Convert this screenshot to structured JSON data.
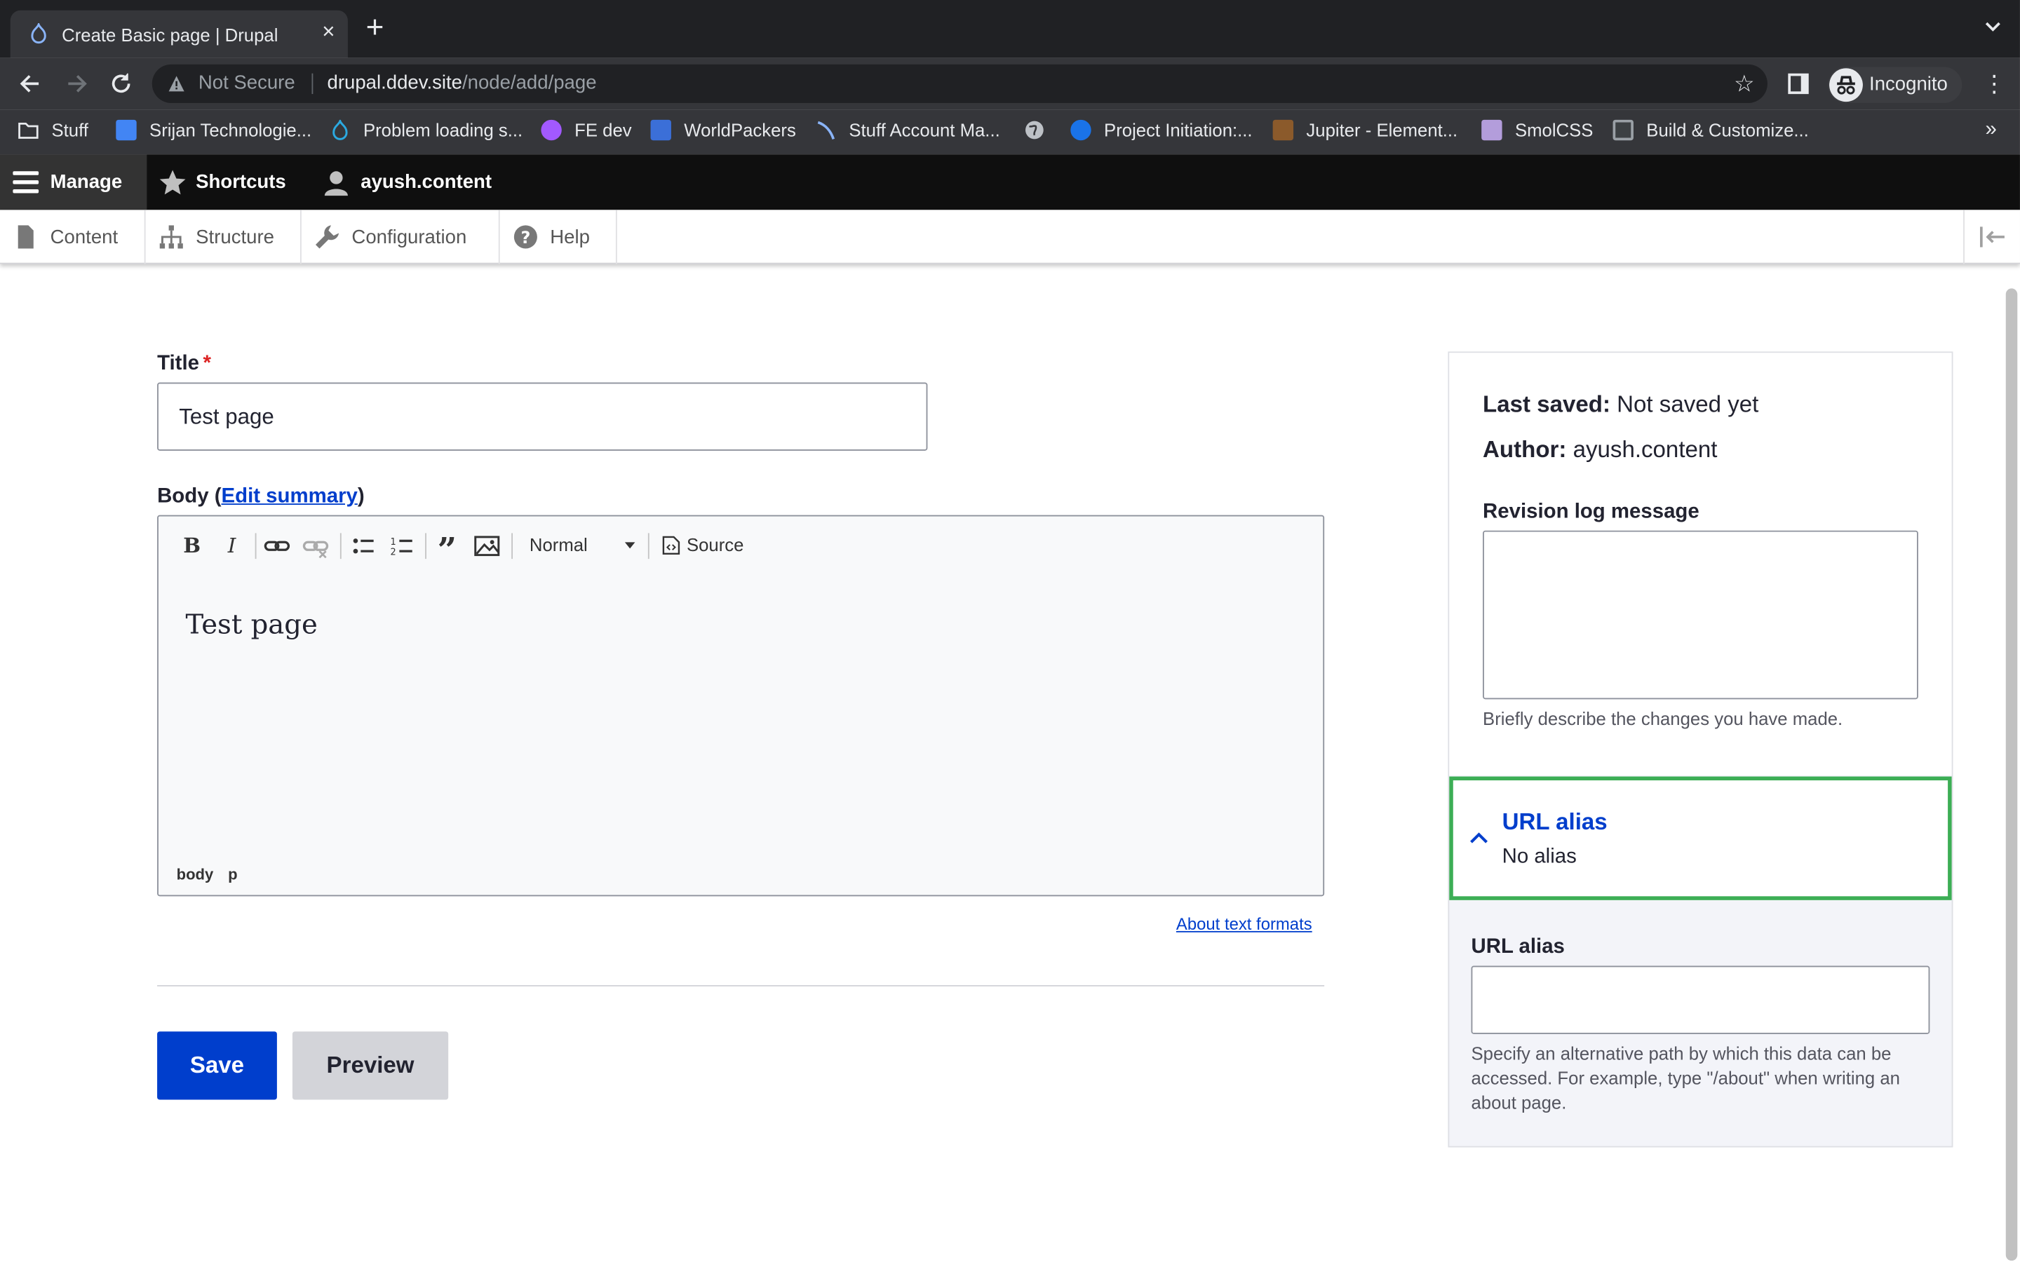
{
  "browser": {
    "tab_title": "Create Basic page | Drupal",
    "address_warning": "Not Secure",
    "url_host": "drupal.ddev.site",
    "url_path": "/node/add/page",
    "profile_label": "Incognito",
    "bookmarks": [
      {
        "label": "Stuff",
        "icon": "folder-icon",
        "color": "#e8eaed"
      },
      {
        "label": "Srijan Technologie...",
        "icon": "calendar-icon",
        "color": "#4285f4"
      },
      {
        "label": "Problem loading s...",
        "icon": "drupal-icon",
        "color": "#2ba9e0"
      },
      {
        "label": "FE dev",
        "icon": "figma-icon",
        "color": "#a259ff"
      },
      {
        "label": "WorldPackers",
        "icon": "worldpackers-icon",
        "color": "#3b6fd8"
      },
      {
        "label": "Stuff Account Ma...",
        "icon": "account-icon",
        "color": "#8ab4f8"
      },
      {
        "label": "",
        "icon": "globe-icon",
        "color": "#bdc1c6"
      },
      {
        "label": "Project Initiation:...",
        "icon": "c-icon",
        "color": "#1a73e8"
      },
      {
        "label": "Jupiter - Element...",
        "icon": "jupiter-icon",
        "color": "#8b5a2b"
      },
      {
        "label": "SmolCSS",
        "icon": "s-icon",
        "color": "#b39ddb"
      },
      {
        "label": "Build & Customize...",
        "icon": "u-icon",
        "color": "#3c4043"
      }
    ]
  },
  "admin_toolbar": {
    "manage": "Manage",
    "shortcuts": "Shortcuts",
    "user": "ayush.content",
    "tray": [
      "Content",
      "Structure",
      "Configuration",
      "Help"
    ]
  },
  "form": {
    "title_label": "Title",
    "title_required_mark": "*",
    "title_value": "Test page",
    "body_label_prefix": "Body (",
    "body_edit_summary": "Edit summary",
    "body_label_suffix": ")",
    "editor": {
      "heading_select": "Normal",
      "source_label": "Source",
      "content": "Test page",
      "path": [
        "body",
        "p"
      ]
    },
    "about_text_formats": "About text formats",
    "save": "Save",
    "preview": "Preview"
  },
  "sidebar": {
    "last_saved_label": "Last saved:",
    "last_saved_value": "Not saved yet",
    "author_label": "Author:",
    "author_value": "ayush.content",
    "revision_label": "Revision log message",
    "revision_value": "",
    "revision_help": "Briefly describe the changes you have made.",
    "url_alias_heading": "URL alias",
    "url_alias_summary": "No alias",
    "url_alias_label": "URL alias",
    "url_alias_value": "",
    "url_alias_help": "Specify an alternative path by which this data can be accessed. For example, type \"/about\" when writing an about page."
  },
  "colors": {
    "primary": "#003ecc",
    "focus": "#3cae55",
    "admin_bar": "#0f0f0f"
  }
}
